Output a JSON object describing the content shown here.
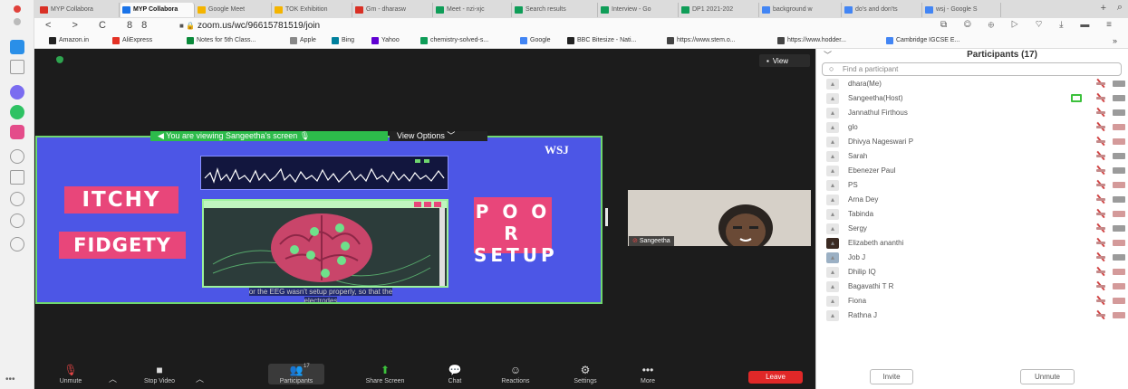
{
  "browser": {
    "tabs": [
      {
        "label": "MYP Collabora",
        "color": "#d93025"
      },
      {
        "label": "MYP Collabora",
        "color": "#1a73e8",
        "active": true
      },
      {
        "label": "Google Meet",
        "color": "#f4b400"
      },
      {
        "label": "TOK Exhibition",
        "color": "#f4b400"
      },
      {
        "label": "Gm - dharasw",
        "color": "#d93025"
      },
      {
        "label": "Meet - nzi-xjc",
        "color": "#0f9d58"
      },
      {
        "label": "Search results",
        "color": "#0f9d58"
      },
      {
        "label": "Interview - Go",
        "color": "#0f9d58"
      },
      {
        "label": "DP1 2021-202",
        "color": "#0f9d58"
      },
      {
        "label": "background w",
        "color": "#4285f4"
      },
      {
        "label": "do's and don'ts",
        "color": "#4285f4"
      },
      {
        "label": "wsj - Google S",
        "color": "#4285f4"
      }
    ],
    "new_tab": "+",
    "nav": "< > C 88",
    "url": "zoom.us/wc/96615781519/join",
    "bookmarks": [
      {
        "label": "Amazon.in",
        "color": "#222"
      },
      {
        "label": "AliExpress",
        "color": "#e43225"
      },
      {
        "label": "Notes for 5th Class...",
        "color": "#0a8a3a"
      },
      {
        "label": "Apple",
        "color": "#888"
      },
      {
        "label": "Bing",
        "color": "#00809d"
      },
      {
        "label": "Yahoo",
        "color": "#6001d2"
      },
      {
        "label": "chemistry-solved-s...",
        "color": "#0f9d58"
      },
      {
        "label": "Google",
        "color": "#4285f4"
      },
      {
        "label": "BBC Bitesize - Nati...",
        "color": "#222"
      },
      {
        "label": "https://www.stem.o...",
        "color": "#444"
      },
      {
        "label": "https://www.hodder...",
        "color": "#444"
      },
      {
        "label": "Cambridge IGCSE E...",
        "color": "#4285f4"
      }
    ],
    "bookmarks_more": "»"
  },
  "meeting": {
    "view_button": "View",
    "share_banner": "You are viewing Sangeetha's screen",
    "view_options": "View Options",
    "shared": {
      "left_text_1": "ITCHY",
      "left_text_2": "FIDGETY",
      "right_text_line1": "P O O R",
      "right_text_line2": "SETUP",
      "logo": "WSJ",
      "subtitle": "or the EEG wasn't setup properly, so that the electrodes"
    },
    "presenter_name": "Sangeetha"
  },
  "toolbar": {
    "buttons": [
      {
        "label": "Unmute",
        "icon": "🎙"
      },
      {
        "label": "Stop Video",
        "icon": "■"
      },
      {
        "label": "Participants",
        "icon": "👥",
        "count": "17"
      },
      {
        "label": "Share Screen",
        "icon": "⬆"
      },
      {
        "label": "Chat",
        "icon": "💬"
      },
      {
        "label": "Reactions",
        "icon": "☺"
      },
      {
        "label": "Settings",
        "icon": "⚙"
      },
      {
        "label": "More",
        "icon": "•••"
      }
    ],
    "leave": "Leave"
  },
  "panel": {
    "title": "Participants (17)",
    "search_placeholder": "Find a participant",
    "participants": [
      {
        "name": "dhara(Me)"
      },
      {
        "name": "Sangeetha(Host)",
        "sharing": true
      },
      {
        "name": "Jannathul Firthous"
      },
      {
        "name": "glo"
      },
      {
        "name": "Dhivya Nageswari P"
      },
      {
        "name": "Sarah"
      },
      {
        "name": "Ebenezer Paul"
      },
      {
        "name": "PS"
      },
      {
        "name": "Arna Dey"
      },
      {
        "name": "Tabinda"
      },
      {
        "name": "Sergy"
      },
      {
        "name": "Elizabeth ananthi"
      },
      {
        "name": "Job J"
      },
      {
        "name": "Dhilip IQ"
      },
      {
        "name": "Bagavathi T R"
      },
      {
        "name": "Fiona"
      },
      {
        "name": "Rathna J"
      }
    ],
    "invite": "Invite",
    "unmute": "Unmute"
  }
}
